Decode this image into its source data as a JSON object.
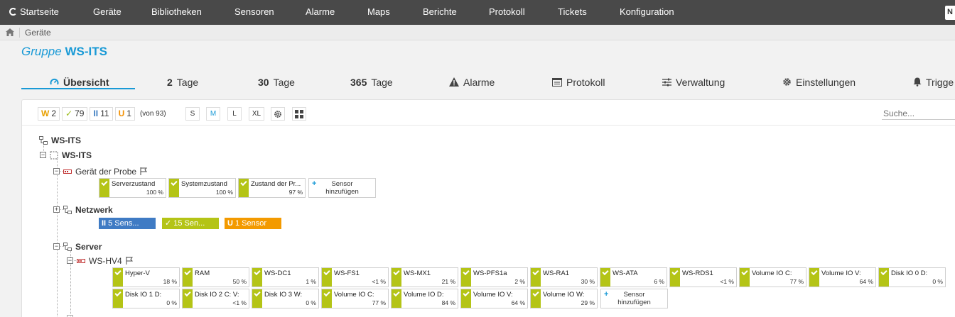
{
  "nav": {
    "items": [
      "Startseite",
      "Geräte",
      "Bibliotheken",
      "Sensoren",
      "Alarme",
      "Maps",
      "Berichte",
      "Protokoll",
      "Tickets",
      "Konfiguration"
    ],
    "user_initial": "N"
  },
  "breadcrumb": {
    "item": "Geräte"
  },
  "title": {
    "prefix": "Gruppe",
    "name": "WS-ITS"
  },
  "tabs": [
    {
      "label": "Übersicht"
    },
    {
      "num": "2",
      "label": "Tage"
    },
    {
      "num": "30",
      "label": "Tage"
    },
    {
      "num": "365",
      "label": "Tage"
    },
    {
      "label": "Alarme"
    },
    {
      "label": "Protokoll"
    },
    {
      "label": "Verwaltung"
    },
    {
      "label": "Einstellungen"
    },
    {
      "label": "Trigge"
    }
  ],
  "counters": {
    "warning": {
      "sym": "W",
      "count": "2"
    },
    "ok": {
      "sym": "✓",
      "count": "79"
    },
    "paused": {
      "sym": "II",
      "count": "11"
    },
    "unusual": {
      "sym": "U",
      "count": "1"
    },
    "total": "(von 93)"
  },
  "sizes": [
    "S",
    "M",
    "L",
    "XL"
  ],
  "search": {
    "placeholder": "Suche..."
  },
  "tree": {
    "root": "WS-ITS",
    "probe": "WS-ITS",
    "device_probe": "Gerät der Probe",
    "network": "Netzwerk",
    "server": "Server",
    "hv4": "WS-HV4"
  },
  "probe_sensors": [
    {
      "name": "Serverzustand",
      "value": "100 %"
    },
    {
      "name": "Systemzustand",
      "value": "100 %"
    },
    {
      "name": "Zustand der Pr...",
      "value": "97 %"
    }
  ],
  "add_sensor": "Sensor hinzufügen",
  "network_groups": [
    {
      "sym": "II",
      "label": "5 Sens...",
      "color": "#3f7bc4"
    },
    {
      "sym": "✓",
      "label": "15 Sen...",
      "color": "#b4c416"
    },
    {
      "sym": "U",
      "label": "1 Sensor",
      "color": "#f39a00"
    }
  ],
  "hv4_sensors_row1": [
    {
      "name": "Hyper-V",
      "value": "18 %"
    },
    {
      "name": "RAM",
      "value": "50 %"
    },
    {
      "name": "WS-DC1",
      "value": "1 %"
    },
    {
      "name": "WS-FS1",
      "value": "<1 %"
    },
    {
      "name": "WS-MX1",
      "value": "21 %"
    },
    {
      "name": "WS-PFS1a",
      "value": "2 %"
    },
    {
      "name": "WS-RA1",
      "value": "30 %"
    },
    {
      "name": "WS-ATA",
      "value": "6 %"
    },
    {
      "name": "WS-RDS1",
      "value": "<1 %"
    },
    {
      "name": "Volume IO C:",
      "value": "77 %"
    },
    {
      "name": "Volume IO V:",
      "value": "64 %"
    },
    {
      "name": "Disk IO 0 D:",
      "value": "0 %"
    }
  ],
  "hv4_sensors_row2": [
    {
      "name": "Disk IO 1 D:",
      "value": "0 %"
    },
    {
      "name": "Disk IO 2 C: V:",
      "value": "<1 %"
    },
    {
      "name": "Disk IO 3 W:",
      "value": "0 %"
    },
    {
      "name": "Volume IO C:",
      "value": "77 %"
    },
    {
      "name": "Volume IO D:",
      "value": "84 %"
    },
    {
      "name": "Volume IO V:",
      "value": "64 %"
    },
    {
      "name": "Volume IO W:",
      "value": "29 %"
    }
  ]
}
